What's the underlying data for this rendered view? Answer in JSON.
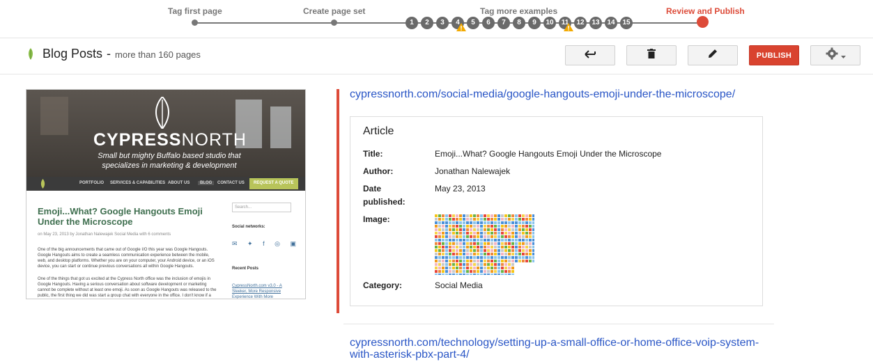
{
  "progress": {
    "steps": [
      {
        "label": "Tag first page"
      },
      {
        "label": "Create page set"
      },
      {
        "label": "Tag more examples"
      },
      {
        "label": "Review and Publish"
      }
    ],
    "example_numbers": [
      "1",
      "2",
      "3",
      "4",
      "5",
      "6",
      "7",
      "8",
      "9",
      "10",
      "11",
      "12",
      "13",
      "14",
      "15"
    ],
    "warning_indices": [
      "4",
      "11"
    ],
    "colors": {
      "track": "#777777",
      "active": "#dd4b39",
      "warning": "#f2a900"
    }
  },
  "header": {
    "title": "Blog Posts",
    "separator": "-",
    "subtitle": "more than 160 pages",
    "icon": "leaf-icon",
    "buttons": {
      "back": "back-arrow-icon",
      "delete": "trash-icon",
      "edit": "pencil-icon",
      "publish": "PUBLISH",
      "settings": "gear-icon"
    }
  },
  "thumbnail": {
    "brand_bold": "CYPRESS",
    "brand_light": "NORTH",
    "tagline": "Small but mighty Buffalo based studio that specializes in marketing & development",
    "nav": [
      "PORTFOLIO",
      "SERVICES & CAPABILITIES",
      "ABOUT US",
      "BLOG",
      "CONTACT US",
      "REQUEST A QUOTE"
    ],
    "post_title": "Emoji...What? Google Hangouts Emoji Under the Microscope",
    "post_meta": "on May 23, 2013   by Jonathan Nalewajek   Social Media   with 6 comments",
    "para1": "One of the big announcements that came out of Google I/O this year was Google Hangouts. Google Hangouts aims to create a seamless communication experience between the mobile, web, and desktop platforms. Whether you are on your computer, your Android device, or an iOS device, you can start or continue previous conversations all within Google Hangouts.",
    "para2": "One of the things that got us excited at the Cypress North office was the inclusion of emojis in Google Hangouts. Having a serious conversation about software development or marketing cannot be complete without at least one emoji. As soon as Google Hangouts was released to the public, the first thing we did was start a group chat with everyone in the office. I don't know if a",
    "search_placeholder": "Search...",
    "social_label": "Social networks:",
    "recent_label": "Recent Posts",
    "recent_item": "CypressNorth.com v3.0 - A Sleeker, More Responsive Experience With More"
  },
  "results": [
    {
      "url": "cypressnorth.com/social-media/google-hangouts-emoji-under-the-microscope/",
      "card": {
        "type": "Article",
        "fields": {
          "title_label": "Title:",
          "title": "Emoji...What? Google Hangouts Emoji Under the Microscope",
          "author_label": "Author:",
          "author": "Jonathan Nalewajek",
          "date_label": "Date published:",
          "date": "May 23, 2013",
          "image_label": "Image:",
          "category_label": "Category:",
          "category": "Social Media"
        }
      }
    },
    {
      "url": "cypressnorth.com/technology/setting-up-a-small-office-or-home-office-voip-system-with-asterisk-pbx-part-4/"
    }
  ]
}
